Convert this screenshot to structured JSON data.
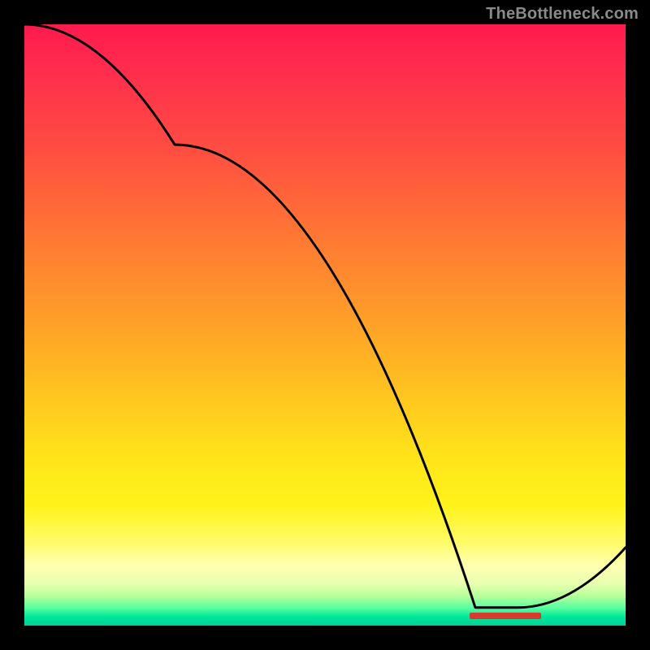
{
  "watermark": "TheBottleneck.com",
  "colors": {
    "line": "#000000",
    "strip": "#d83a2f",
    "frame": "#000000",
    "gradient_top": "#ff1a4d",
    "gradient_bottom": "#00d094"
  },
  "chart_data": {
    "type": "line",
    "title": "",
    "xlabel": "",
    "ylabel": "",
    "xlim": [
      0,
      100
    ],
    "ylim": [
      0,
      100
    ],
    "x": [
      0,
      25,
      75,
      82,
      100
    ],
    "values": [
      100,
      80,
      3,
      3,
      13
    ],
    "optimal_band_x": [
      74,
      86
    ],
    "notes": "Single black curve over a vertical heat gradient. No axis ticks or numeric labels are rendered in the source image; x/y values are approximate, read off relative position. The optimal (near-zero) region is marked by a short red strip along the bottom."
  }
}
